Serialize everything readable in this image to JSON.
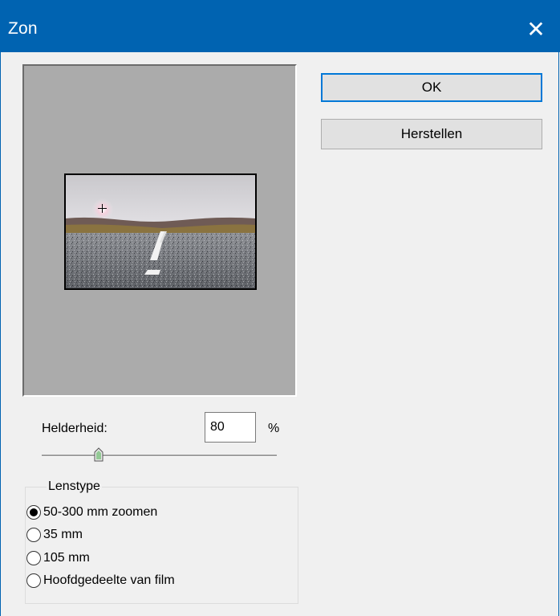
{
  "window": {
    "title": "Zon",
    "close_glyph": "✕",
    "titlebar_color": "#0063b1"
  },
  "buttons": {
    "ok": "OK",
    "reset": "Herstellen"
  },
  "brightness": {
    "label": "Helderheid:",
    "value": "80",
    "unit": "%",
    "slider_fraction": 0.24
  },
  "lens": {
    "group_label": "Lenstype",
    "options": [
      {
        "label": "50-300 mm zoomen",
        "checked": true
      },
      {
        "label": "35 mm",
        "checked": false
      },
      {
        "label": "105 mm",
        "checked": false
      },
      {
        "label": "Hoofdgedeelte van film",
        "checked": false
      }
    ]
  },
  "preview": {
    "marker_icon": "crosshair-icon"
  }
}
